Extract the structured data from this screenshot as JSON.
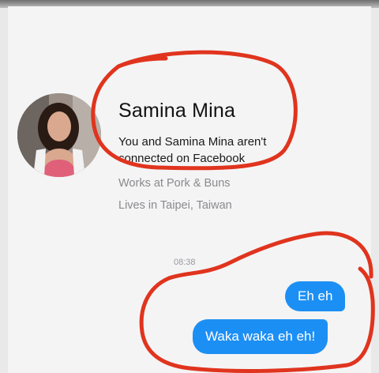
{
  "profile": {
    "name": "Samina Mina",
    "connection_text": "You and Samina Mina aren't connected on Facebook",
    "work": "Works at Pork & Buns",
    "location": "Lives in Taipei, Taiwan"
  },
  "chat": {
    "timestamp": "08:38",
    "messages": [
      {
        "text": "Eh eh",
        "direction": "outgoing"
      },
      {
        "text": "Waka waka eh eh!",
        "direction": "outgoing"
      }
    ]
  },
  "colors": {
    "bubble": "#1c8ff4",
    "annotation": "#e0341e"
  }
}
